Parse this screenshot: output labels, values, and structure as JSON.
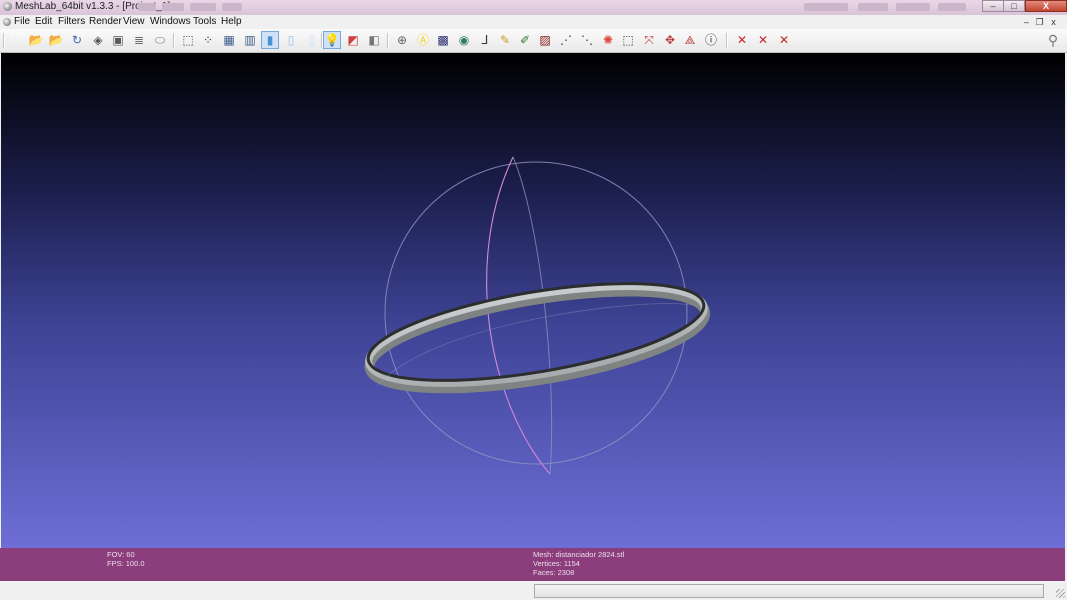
{
  "window": {
    "title": "MeshLab_64bit v1.3.3 - [Project_1]",
    "controls": {
      "minimize": "–",
      "maximize": "□",
      "close": "X"
    }
  },
  "menubar": {
    "items": [
      "File",
      "Edit",
      "Filters",
      "Render",
      "View",
      "Windows",
      "Tools",
      "Help"
    ],
    "mdi_controls": {
      "minimize": "–",
      "restore": "❐",
      "close": "x"
    }
  },
  "toolbar": {
    "buttons": [
      {
        "name": "new-project-icon",
        "glyph": "🗋",
        "color": "#ffffff"
      },
      {
        "name": "open-project-icon",
        "glyph": "📂",
        "color": "#e8c04a"
      },
      {
        "name": "open-mesh-icon",
        "glyph": "📂",
        "color": "#e8c04a"
      },
      {
        "name": "reload-icon",
        "glyph": "↻",
        "color": "#3a6bb0"
      },
      {
        "name": "save-icon",
        "glyph": "◈",
        "color": "#555555"
      },
      {
        "name": "snapshot-icon",
        "glyph": "▣",
        "color": "#5a5a5a"
      },
      {
        "name": "layers-icon",
        "glyph": "≣",
        "color": "#6b6b6b"
      },
      {
        "name": "box-icon",
        "glyph": "⬭",
        "color": "#7a7a7a"
      },
      {
        "name": "bounding-box-icon",
        "glyph": "⬚",
        "color": "#444444"
      },
      {
        "name": "points-icon",
        "glyph": "⁘",
        "color": "#333333"
      },
      {
        "name": "wireframe-icon",
        "glyph": "▦",
        "color": "#3b5b8a"
      },
      {
        "name": "hidden-lines-icon",
        "glyph": "▥",
        "color": "#3b5b8a"
      },
      {
        "name": "flat-lines-icon",
        "glyph": "▮",
        "color": "#4a8fd0"
      },
      {
        "name": "flat-icon",
        "glyph": "▯",
        "color": "#8fc2ef"
      },
      {
        "name": "smooth-icon",
        "glyph": "▯",
        "color": "#c7dff6"
      },
      {
        "name": "texture-icon",
        "glyph": "▤",
        "color": "#a0a0a0"
      },
      {
        "name": "light-icon",
        "glyph": "💡",
        "color": "#f0c020"
      },
      {
        "name": "fancy-lighting-icon",
        "glyph": "◩",
        "color": "#d04040"
      },
      {
        "name": "back-face-icon",
        "glyph": "◧",
        "color": "#777777"
      },
      {
        "name": "select-faces-icon",
        "glyph": "⊕",
        "color": "#666666"
      },
      {
        "name": "annotate-icon",
        "glyph": "Ⓐ",
        "color": "#f3d51a"
      },
      {
        "name": "layer-dialog-icon",
        "glyph": "▩",
        "color": "#2c2c6e"
      },
      {
        "name": "globe-icon",
        "glyph": "◉",
        "color": "#2f7a6a"
      },
      {
        "name": "axis-icon",
        "glyph": "⅃",
        "color": "#333333"
      },
      {
        "name": "paint-icon",
        "glyph": "✎",
        "color": "#c8a020"
      },
      {
        "name": "brush-icon",
        "glyph": "✐",
        "color": "#2e7d32"
      },
      {
        "name": "texture-paint-icon",
        "glyph": "▨",
        "color": "#8b1a1a"
      },
      {
        "name": "select-vertices-icon",
        "glyph": "⋰",
        "color": "#3a3a3a"
      },
      {
        "name": "select-connected-icon",
        "glyph": "⋱",
        "color": "#3a3a3a"
      },
      {
        "name": "color-select-icon",
        "glyph": "✺",
        "color": "#d9463b"
      },
      {
        "name": "select-region-icon",
        "glyph": "⬚",
        "color": "#333333"
      },
      {
        "name": "align-icon",
        "glyph": "⤧",
        "color": "#c04040"
      },
      {
        "name": "manipulator-icon",
        "glyph": "✥",
        "color": "#b83a3a"
      },
      {
        "name": "measure-icon",
        "glyph": "⟁",
        "color": "#b83a3a"
      },
      {
        "name": "info-icon",
        "glyph": "ⓘ",
        "color": "#2b2b2b"
      },
      {
        "name": "delete-faces-icon",
        "glyph": "✕",
        "color": "#c62828"
      },
      {
        "name": "delete-vertices-icon",
        "glyph": "✕",
        "color": "#c62828"
      },
      {
        "name": "delete-selection-icon",
        "glyph": "✕",
        "color": "#c62828"
      }
    ],
    "search_glyph": "⚲"
  },
  "viewport": {
    "trackball_colors": {
      "equator": "#9a9ac8",
      "vertical": "#d08ad8",
      "ring_light": "#c9cbcf",
      "ring_dark": "#3b3f3d"
    }
  },
  "info": {
    "fov": "FOV: 60",
    "fps": "FPS:   100.0",
    "mesh": "Mesh: distanciador 2824.stl",
    "vertices": "Vertices: 1154",
    "faces": "Faces: 2308"
  }
}
